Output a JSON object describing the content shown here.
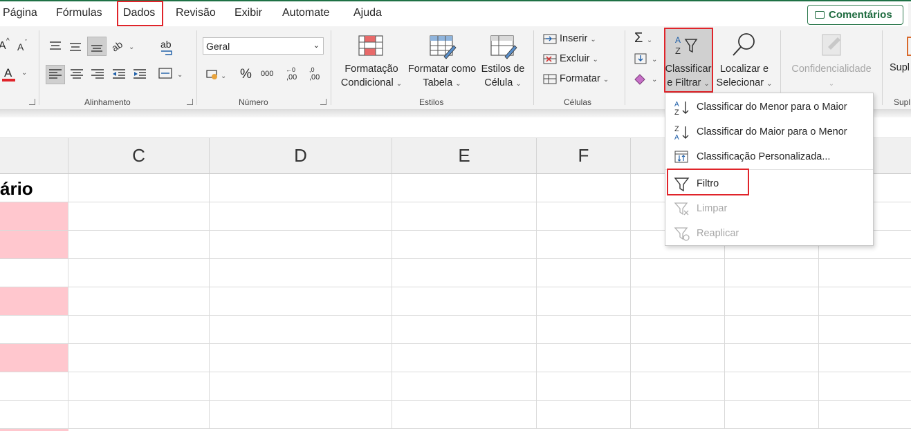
{
  "tabs": {
    "pagina": "Página",
    "formulas": "Fórmulas",
    "dados": "Dados",
    "revisao": "Revisão",
    "exibir": "Exibir",
    "automate": "Automate",
    "ajuda": "Ajuda"
  },
  "comments_label": "Comentários",
  "ribbon": {
    "font_grow": "A",
    "font_shrink": "A",
    "font_color": "A",
    "wrap_glyph": "ab",
    "number_format": "Geral",
    "percent": "%",
    "thousands": "000",
    "inc_decimal": ",00",
    "dec_decimal": ",00",
    "groups": {
      "alinhamento": "Alinhamento",
      "numero": "Número",
      "estilos": "Estilos",
      "celulas": "Células",
      "suplementos": "Supl"
    },
    "cond_format_1": "Formatação",
    "cond_format_2": "Condicional",
    "format_table_1": "Formatar como",
    "format_table_2": "Tabela",
    "cell_styles_1": "Estilos de",
    "cell_styles_2": "Célula",
    "insert": "Inserir",
    "delete": "Excluir",
    "format": "Formatar",
    "sort_filter_1": "Classificar",
    "sort_filter_2": "e Filtrar",
    "find_select_1": "Localizar e",
    "find_select_2": "Selecionar",
    "sensitivity": "Confidencialidade",
    "addins": "Supl"
  },
  "columns": [
    "C",
    "D",
    "E",
    "F"
  ],
  "cell_a1": "ário",
  "menu": {
    "sort_asc": "Classificar do Menor para o Maior",
    "sort_desc": "Classificar do Maior para o Menor",
    "custom_sort": "Classificação Personalizada...",
    "filter": "Filtro",
    "clear": "Limpar",
    "reapply": "Reaplicar"
  },
  "colors": {
    "accent_green": "#1e7145",
    "highlight_red": "#e0242a",
    "pink_fill": "#ffc7ce"
  },
  "icons": [
    "sort-az-icon",
    "filter-funnel-icon",
    "magnifier-icon",
    "autosum-icon",
    "fill-icon",
    "eraser-icon",
    "comment-icon"
  ]
}
